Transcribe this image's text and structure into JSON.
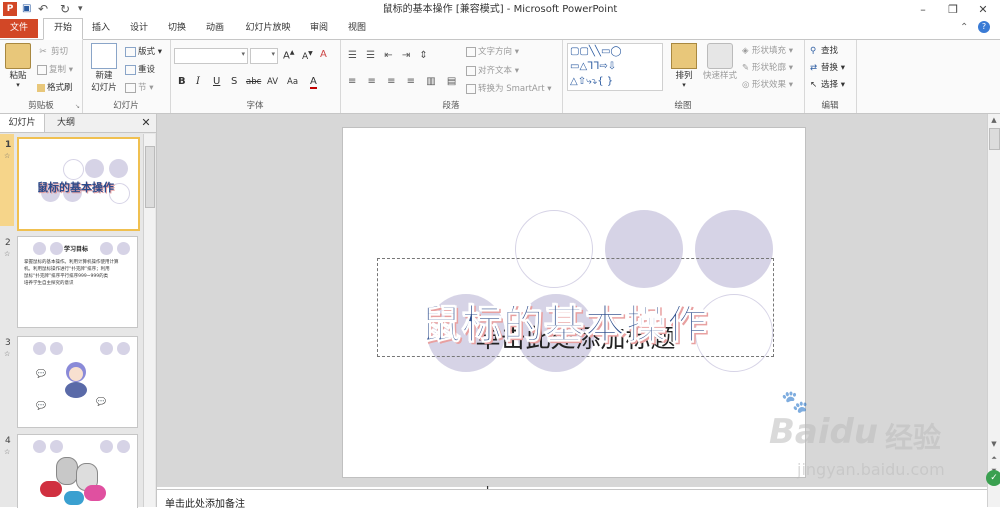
{
  "window": {
    "title": "鼠标的基本操作 [兼容模式] - Microsoft PowerPoint",
    "minimize": "–",
    "maximize": "❐",
    "close": "✕"
  },
  "quick_access": {
    "app_icon": "P",
    "save": "💾",
    "undo": "↶",
    "redo": "↻",
    "customize": "▾"
  },
  "tabs": [
    "文件",
    "开始",
    "插入",
    "设计",
    "切换",
    "动画",
    "幻灯片放映",
    "审阅",
    "视图"
  ],
  "ribbon": {
    "clipboard": {
      "label": "剪贴板",
      "paste": "粘贴",
      "cut": "剪切",
      "copy": "复制",
      "format_painter": "格式刷"
    },
    "slides": {
      "label": "幻灯片",
      "new_slide": "新建",
      "new_slide2": "幻灯片",
      "layout": "版式",
      "reset": "重设",
      "section": "节"
    },
    "font": {
      "label": "字体",
      "font_name": "",
      "font_size": "",
      "grow": "A",
      "shrink": "A",
      "clear": "A",
      "bold": "B",
      "italic": "I",
      "underline": "U",
      "shadow": "S",
      "strike": "abc",
      "spacing": "AV",
      "case": "Aa",
      "color": "A"
    },
    "paragraph": {
      "label": "段落",
      "text_direction": "文字方向",
      "align_text": "对齐文本",
      "smartart": "转换为 SmartArt"
    },
    "drawing": {
      "label": "绘图",
      "arrange": "排列",
      "quick_styles": "快速样式",
      "shape_fill": "形状填充",
      "shape_outline": "形状轮廓",
      "shape_effects": "形状效果"
    },
    "editing": {
      "label": "编辑",
      "find": "查找",
      "replace": "替换",
      "select": "选择"
    }
  },
  "panel": {
    "tab_slides": "幻灯片",
    "tab_outline": "大纲",
    "close": "✕",
    "thumbs": [
      {
        "num": "1",
        "title": "鼠标的基本操作"
      },
      {
        "num": "2",
        "title": "学习目标",
        "bullets": [
          "掌握鼠标的基本操作。利用计算机操作使用计算",
          "机。利用鼠标操作进行“扑克牌”排序；利用",
          "鼠标“扑克牌”排序平行排序999~999的类",
          "培养学生自主探究的意识"
        ]
      },
      {
        "num": "3"
      },
      {
        "num": "4"
      }
    ]
  },
  "slide": {
    "title_art": "鼠标的基本操作",
    "placeholder": "单击此处添加标题"
  },
  "notes": {
    "placeholder": "单击此处添加备注"
  },
  "watermark": {
    "brand": "Bai",
    "brand2": "du",
    "cn": "经验",
    "url": "jingyan.baidu.com"
  },
  "colors": {
    "file_tab": "#d24726",
    "circle_fill": "#d6d3e6",
    "circle_stroke": "#d6d3e6",
    "wordart_fill": "#2a4a8a",
    "wordart_shadow": "#e8a0a0"
  }
}
